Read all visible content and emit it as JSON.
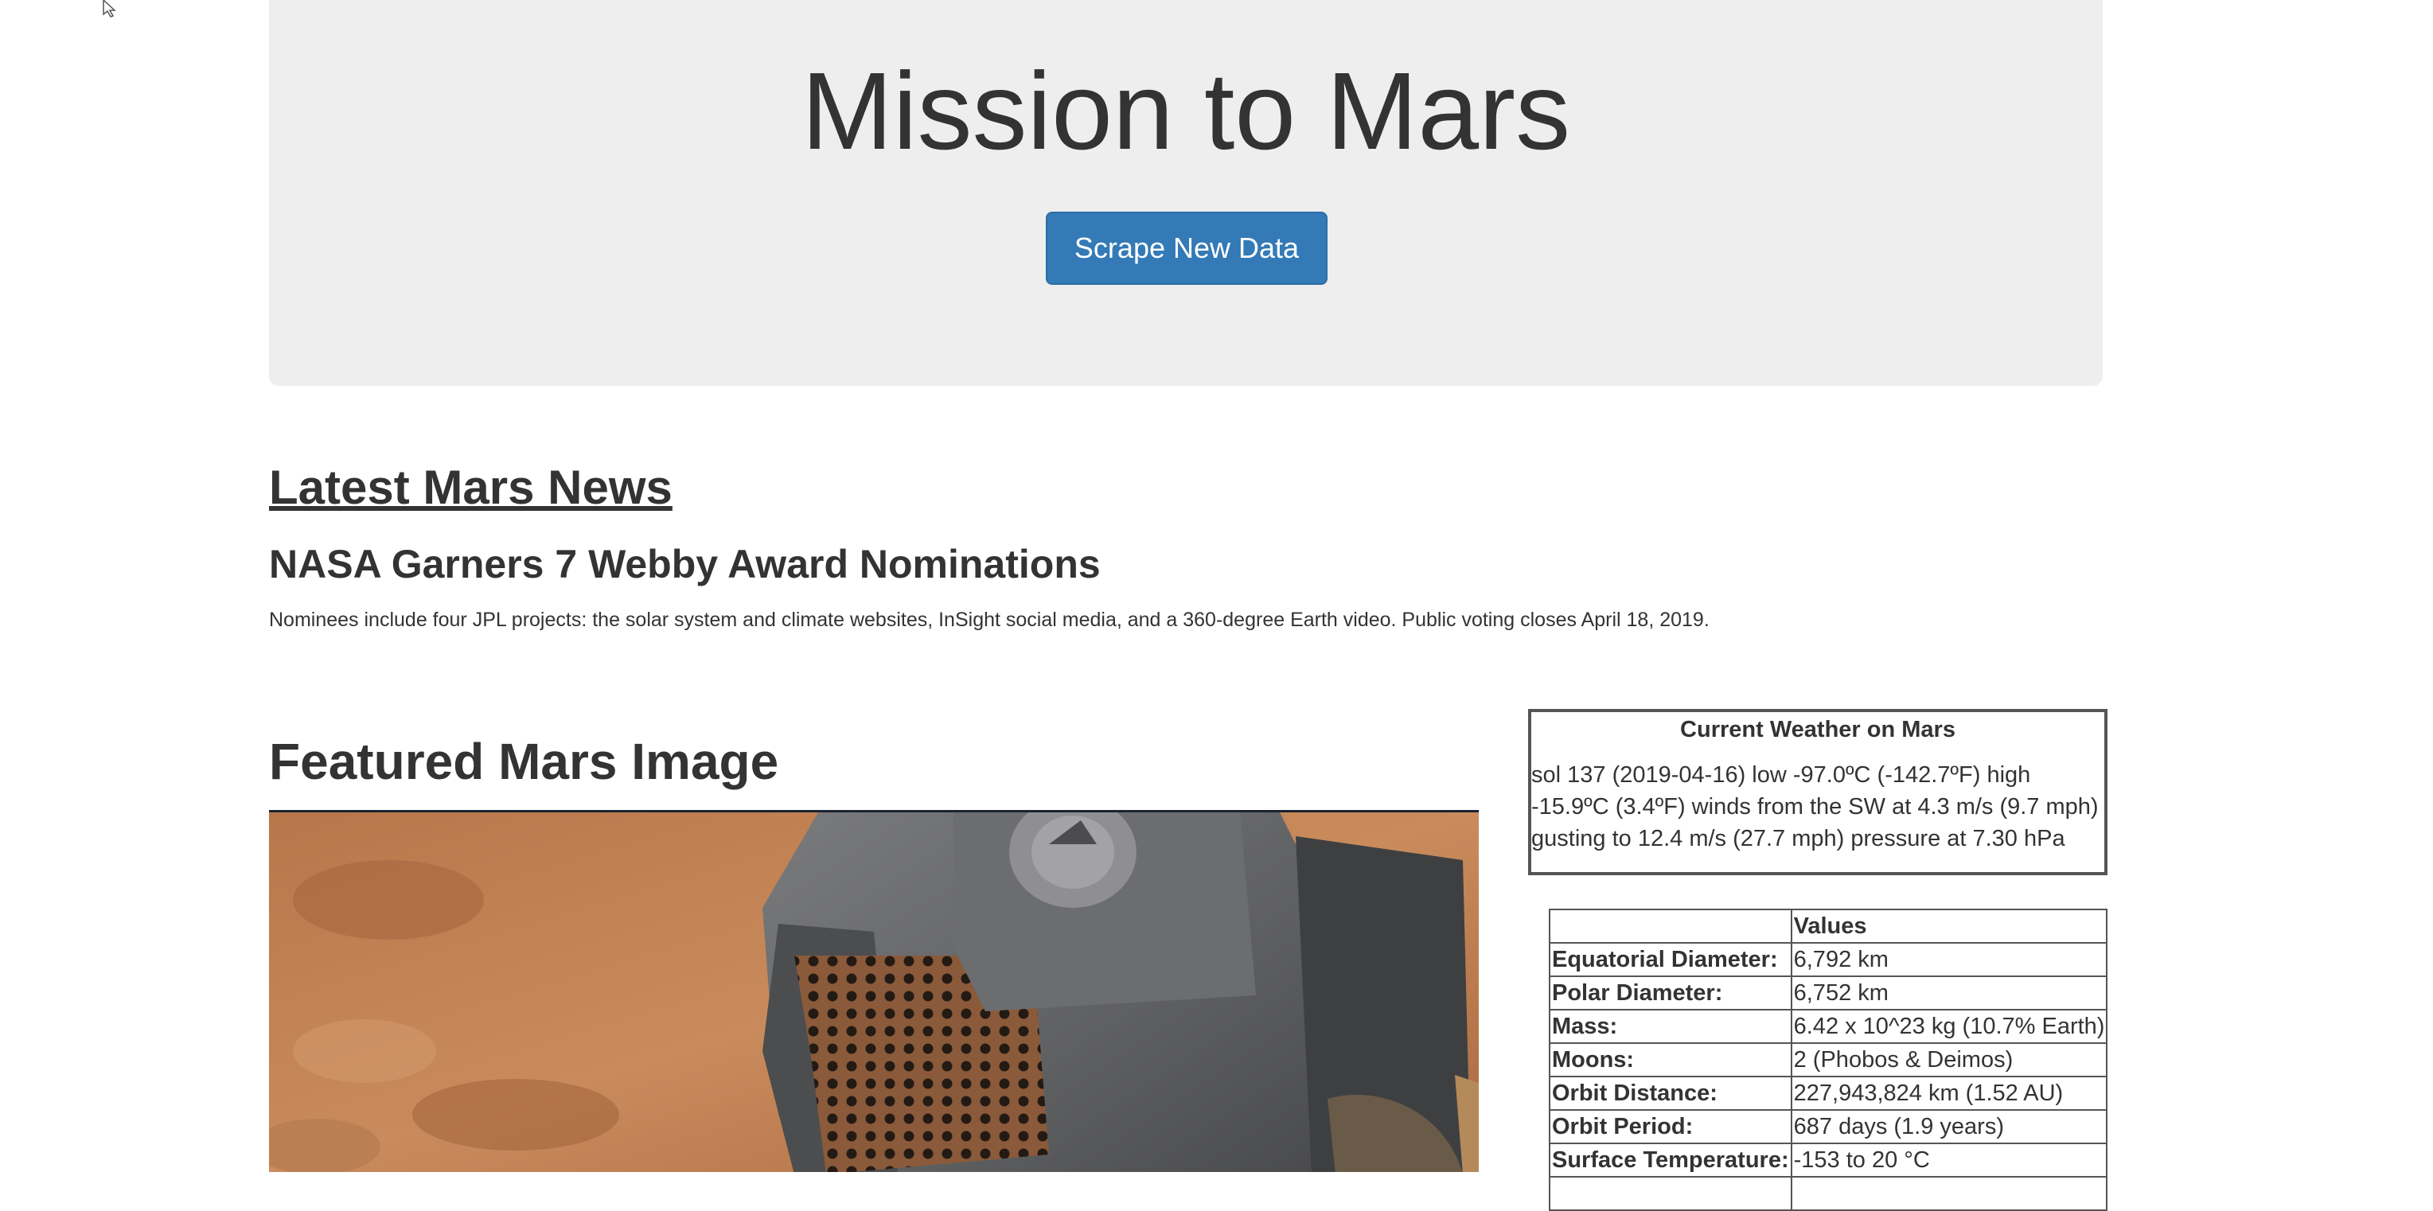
{
  "jumbotron": {
    "title": "Mission to Mars",
    "button_label": "Scrape New Data"
  },
  "news": {
    "section_title": "Latest Mars News",
    "headline": "NASA Garners 7 Webby Award Nominations",
    "teaser": "Nominees include four JPL projects: the solar system and climate websites, InSight social media, and a 360-degree Earth video. Public voting closes April 18, 2019."
  },
  "featured": {
    "title": "Featured Mars Image"
  },
  "weather": {
    "title": "Current Weather on Mars",
    "text": "sol 137 (2019-04-16) low -97.0ºC (-142.7ºF) high -15.9ºC (3.4ºF) winds from the SW at 4.3 m/s (9.7 mph) gusting to 12.4 m/s (27.7 mph) pressure at 7.30 hPa"
  },
  "facts": {
    "header_value": "Values",
    "rows": [
      {
        "label": "Equatorial Diameter:",
        "value": "6,792 km"
      },
      {
        "label": "Polar Diameter:",
        "value": "6,752 km"
      },
      {
        "label": "Mass:",
        "value": "6.42 x 10^23 kg (10.7% Earth)"
      },
      {
        "label": "Moons:",
        "value": "2 (Phobos & Deimos)"
      },
      {
        "label": "Orbit Distance:",
        "value": "227,943,824 km (1.52 AU)"
      },
      {
        "label": "Orbit Period:",
        "value": "687 days (1.9 years)"
      },
      {
        "label": "Surface Temperature:",
        "value": "-153 to 20 °C"
      },
      {
        "label": "",
        "value": ""
      }
    ]
  },
  "colors": {
    "jumbotron_bg": "#eeeeee",
    "button_bg": "#337ab7",
    "text": "#333333"
  }
}
